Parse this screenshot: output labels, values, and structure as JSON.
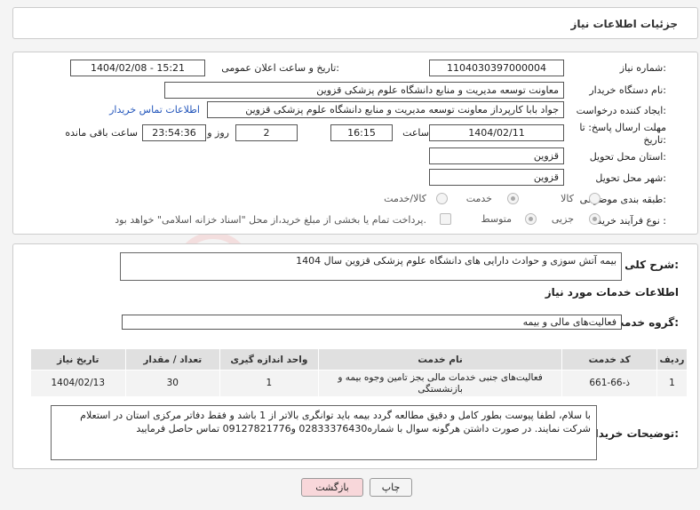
{
  "page_title": "جزئیات اطلاعات نیاز",
  "labels": {
    "need_number": "شماره نیاز:",
    "public_announce": "تاریخ و ساعت اعلان عمومی:",
    "buyer_org": "نام دستگاه خریدار:",
    "requester": "ایجاد کننده درخواست:",
    "deadline": "مهلت ارسال پاسخ: تا تاریخ:",
    "time_word": "ساعت",
    "days_word": "روز و",
    "remaining": "ساعت باقی مانده",
    "province": "استان محل تحویل:",
    "city": "شهر محل تحویل:",
    "category": "طبقه بندی موضوعی:",
    "purchase_type": "نوع فرآیند خرید :",
    "summary": "شرح کلی نیاز:",
    "services_info": "اطلاعات خدمات مورد نیاز",
    "service_group": "گروه خدمت:",
    "buyer_notes": "توضیحات خریدار:"
  },
  "fields": {
    "need_number": "1104030397000004",
    "public_announce": "1404/02/08 - 15:21",
    "buyer_org": "معاونت توسعه مدیریت و منابع دانشگاه علوم پزشکی قزوین",
    "requester": "جواد بابا کارپرداز معاونت توسعه مدیریت و منابع دانشگاه علوم پزشکی قزوین",
    "contact_link": "اطلاعات تماس خریدار",
    "deadline_date": "1404/02/11",
    "deadline_time": "16:15",
    "days": "2",
    "remaining_time": "23:54:36",
    "province": "قزوین",
    "city": "قزوین",
    "summary": "بیمه آتش سوزی و حوادث دارایی های دانشگاه علوم پزشکی قزوین سال 1404",
    "service_group": "فعالیت‌های مالی و بیمه",
    "buyer_notes": "با سلام، لطفا پیوست بطور کامل و دقیق مطالعه گردد  بیمه باید توانگری بالاتر از 1 باشد و فقط دفاتر مرکزی استان در استعلام شرکت نمایند. در صورت داشتن هرگونه سوال با شماره02833376430 و09127821776 تماس حاصل فرمایید"
  },
  "category_options": [
    "کالا",
    "خدمت",
    "کالا/خدمت"
  ],
  "category_selected": "خدمت",
  "purchase_options": [
    "جزیی",
    "متوسط"
  ],
  "purchase_selected": "جزیی",
  "payment_note": "پرداخت تمام یا بخشی از مبلغ خرید،از محل \"اسناد خزانه اسلامی\" خواهد بود.",
  "table": {
    "headers": [
      "ردیف",
      "کد خدمت",
      "نام خدمت",
      "واحد اندازه گیری",
      "تعداد / مقدار",
      "تاریخ نیاز"
    ],
    "rows": [
      [
        "1",
        "ذ-66-661",
        "فعالیت‌های جنبی خدمات مالی بجز تامین وجوه بیمه و بازنشستگی",
        "1",
        "30",
        "1404/02/13"
      ]
    ]
  },
  "buttons": {
    "print": "چاپ",
    "back": "بازگشت"
  },
  "colors": {
    "back_button_bg": "#f8d7da",
    "link": "#2255bb"
  }
}
